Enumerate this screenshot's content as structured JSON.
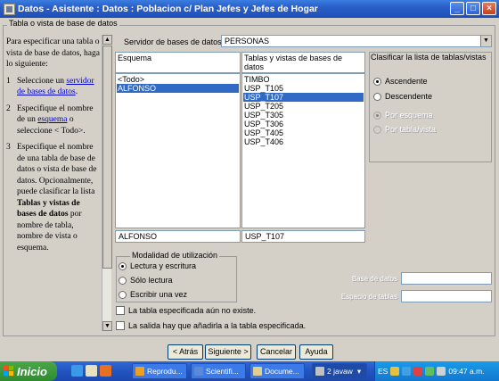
{
  "window": {
    "title": "Datos - Asistente : Datos : Poblacion c/ Plan Jefes y Jefes de Hogar",
    "minimize": "_",
    "maximize": "□",
    "close": "×"
  },
  "group_title": "Tabla o vista de base de datos",
  "help": {
    "intro": "Para especificar una tabla o vista de base de datos, haga lo siguiente:",
    "steps": [
      {
        "num": "1",
        "pre": "Seleccione un ",
        "link": "servidor de bases de datos",
        "post": "."
      },
      {
        "num": "2",
        "pre": "Especifique el nombre de un ",
        "link": "esquema",
        "post": " o seleccione < Todo>."
      },
      {
        "num": "3",
        "pre": "Especifique el nombre de una tabla de base de datos o vista de base de datos. Opcionalmente, puede clasificar la lista ",
        "bold": "Tablas y vistas de bases de datos",
        "post": " por nombre de tabla, nombre de vista o esquema."
      }
    ]
  },
  "server": {
    "label": "Servidor de bases de datos",
    "value": "PERSONAS"
  },
  "schema": {
    "header": "Esquema",
    "items": [
      "<Todo>",
      "ALFONSO"
    ],
    "selected_index": 1,
    "value": "ALFONSO"
  },
  "tables": {
    "header": "Tablas y vistas de bases de datos",
    "items": [
      "TIMBO",
      "USP_T105",
      "USP_T107",
      "USP_T205",
      "USP_T305",
      "USP_T306",
      "USP_T405",
      "USP_T406"
    ],
    "selected_index": 2,
    "value": "USP_T107"
  },
  "sort": {
    "title": "Clasificar la lista de tablas/vistas",
    "ascending": "Ascendente",
    "descending": "Descendente",
    "by_schema": "Por esquema",
    "by_table": "Por tabla/vista"
  },
  "mode": {
    "title": "Modalidad de utilización",
    "read_write": "Lectura y escritura",
    "read_only": "Sólo lectura",
    "write_once": "Escribir una vez"
  },
  "checks": {
    "not_exists": "La tabla especificada aún no existe.",
    "append": "La salida hay que añadirla a la tabla especificada."
  },
  "base": {
    "db_label": "Base de datos",
    "table_space_label": "Espacio de tablas"
  },
  "buttons": {
    "back": "< Atrás",
    "next": "Siguiente >",
    "cancel": "Cancelar",
    "help": "Ayuda"
  },
  "taskbar": {
    "start": "Inicio",
    "tasks": [
      "Reprodu...",
      "Scientifi...",
      "Docume...",
      "2 javaw"
    ],
    "lang": "ES",
    "clock": "09:47 a.m."
  },
  "colors": {
    "selection": "#316ac5",
    "titlebar": "#2a5fc8",
    "link": "#0000cc"
  }
}
